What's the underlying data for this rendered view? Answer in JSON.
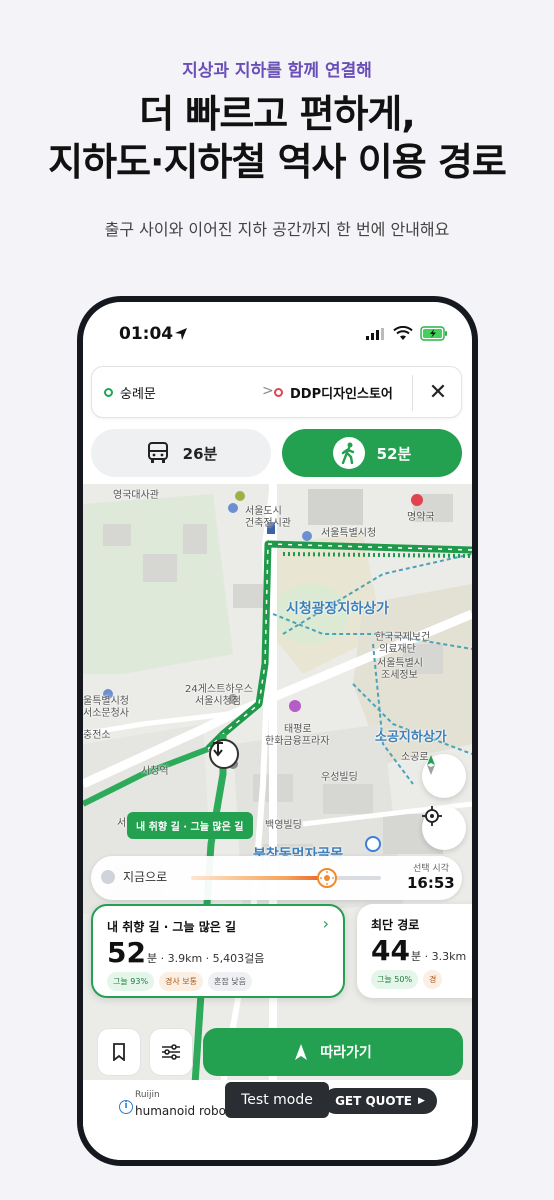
{
  "promo": {
    "subtitle": "지상과 지하를 함께 연결해",
    "title_line1": "더 빠르고 편하게,",
    "title_line2": "지하도·지하철 역사 이용 경로",
    "description": "출구 사이와 이어진 지하 공간까지 한 번에 안내해요"
  },
  "status_bar": {
    "time": "01:04"
  },
  "route": {
    "origin": "숭례문",
    "destination": "DDP디자인스토어",
    "chevron": ">",
    "close": "✕"
  },
  "modes": {
    "transit_time": "26분",
    "walk_time": "52분"
  },
  "map_labels": {
    "l1": "영국대사관",
    "l2": "서울도시",
    "l3": "건축전시관",
    "l4": "명약국",
    "l5": "서울특별시청",
    "l6": "시청광장지하상가",
    "l7": "한국국제보건",
    "l8": "의료재단",
    "l9": "서울특별시",
    "l10": "조세정보",
    "l11": "24게스트하우스",
    "l12": "서울시청점",
    "l13": "울특별시청",
    "l14": "서소문청사",
    "l15": "충전소",
    "l16": "태평로",
    "l17": "한화금융프라자",
    "l18": "소공지하상가",
    "l19": "소공로",
    "l20": "우성빌딩",
    "l21": "시청역",
    "l22": "백영빌딩",
    "l23": "북창동먹자골목",
    "l24": "서"
  },
  "route_tag": "내 취향 길 · 그늘 많은 길",
  "time_slider": {
    "now_label": "지금으로",
    "selected_label": "선택 시각",
    "selected_time": "16:53",
    "position": 0.7
  },
  "cards": {
    "main": {
      "title": "내 취향 길 · 그늘 많은 길",
      "minutes": "52",
      "meta": "분 · 3.9km · 5,403걸음",
      "chip_shade": "그늘 93%",
      "chip_slope": "경사 보통",
      "chip_crowd": "혼잡 낮음"
    },
    "alt": {
      "title": "최단 경로",
      "minutes": "44",
      "meta": "분 · 3.3km",
      "chip_shade": "그늘 50%",
      "chip_slope": "경"
    }
  },
  "bottom": {
    "follow_label": "따라가기"
  },
  "ad": {
    "brand": "Ruijin",
    "product": "humanoid robot",
    "test_mode": "Test mode",
    "cta": "GET QUOTE"
  },
  "colors": {
    "accent_green": "#23a050",
    "promo_purple": "#6a4fb8",
    "route_blue": "#3e7fb8"
  }
}
